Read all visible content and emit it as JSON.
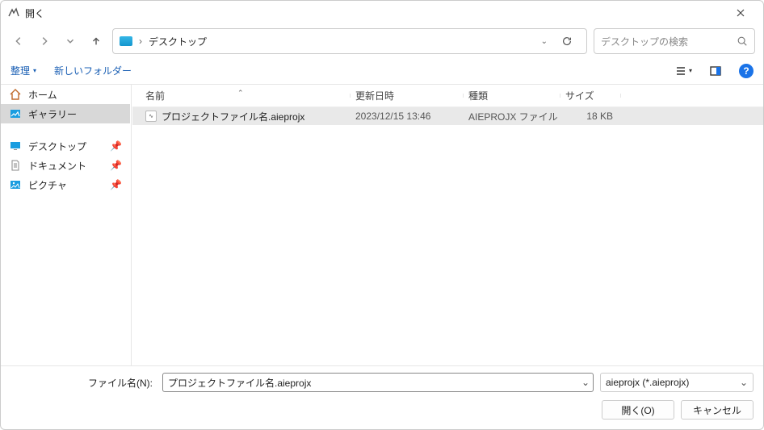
{
  "window": {
    "title": "開く"
  },
  "nav": {
    "crumb": "デスクトップ"
  },
  "search": {
    "placeholder": "デスクトップの検索"
  },
  "toolbar": {
    "organize": "整理",
    "newfolder": "新しいフォルダー"
  },
  "sidebar": {
    "home": "ホーム",
    "gallery": "ギャラリー",
    "desktop": "デスクトップ",
    "documents": "ドキュメント",
    "pictures": "ピクチャ"
  },
  "columns": {
    "name": "名前",
    "date": "更新日時",
    "type": "種類",
    "size": "サイズ"
  },
  "file": {
    "name": "プロジェクトファイル名.aieprojx",
    "date": "2023/12/15 13:46",
    "type": "AIEPROJX ファイル",
    "size": "18 KB"
  },
  "footer": {
    "filename_label": "ファイル名(N):",
    "filename_value": "プロジェクトファイル名.aieprojx",
    "filter": "aieprojx (*.aieprojx)",
    "open": "開く(O)",
    "cancel": "キャンセル"
  }
}
